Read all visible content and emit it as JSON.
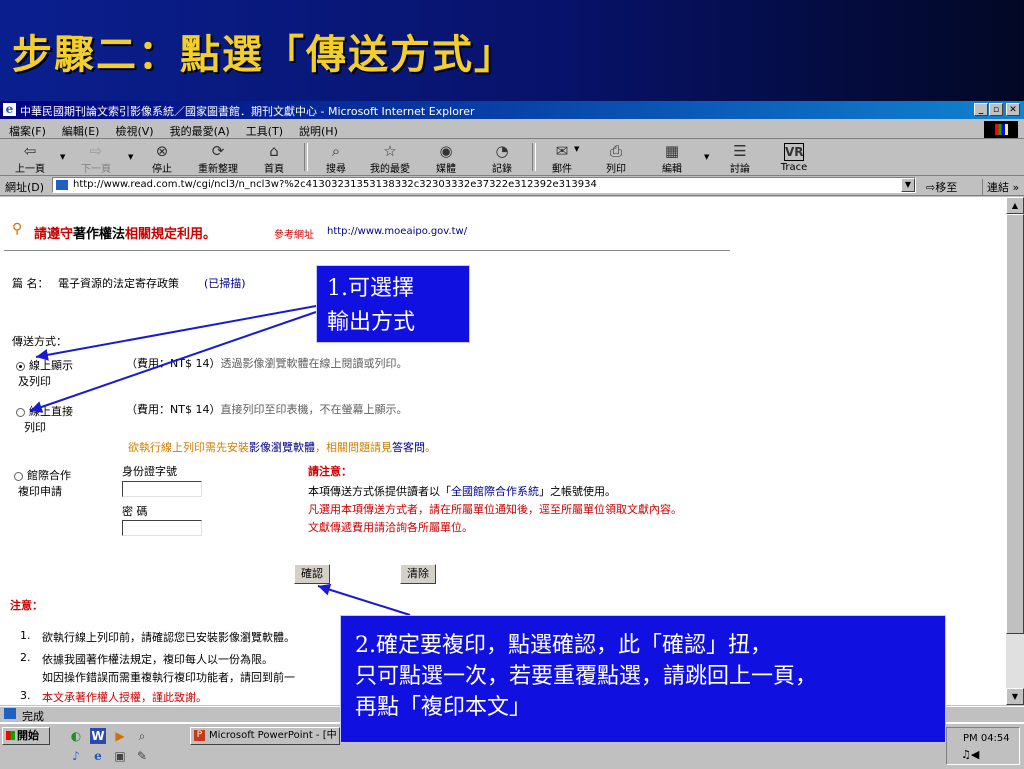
{
  "slide": {
    "title": "步驟二：點選「傳送方式」"
  },
  "window": {
    "title": "中華民國期刊論文索引影像系統／國家圖書館．期刊文獻中心 - Microsoft Internet Explorer",
    "controls": [
      "_",
      "▫",
      "✕"
    ]
  },
  "menu": [
    "檔案(F)",
    "編輯(E)",
    "檢視(V)",
    "我的最愛(A)",
    "工具(T)",
    "說明(H)"
  ],
  "toolbar": {
    "back": "上一頁",
    "forward": "下一頁",
    "stop": "停止",
    "refresh": "重新整理",
    "home": "首頁",
    "search": "搜尋",
    "favorites": "我的最愛",
    "media": "媒體",
    "history": "記錄",
    "mail": "郵件",
    "print": "列印",
    "edit": "編輯",
    "discuss": "討論",
    "trace": "Trace"
  },
  "address": {
    "label": "網址(D)",
    "url": "http://www.read.com.tw/cgi/ncl3/n_ncl3w?%2c41303231353138332c32303332e37322e312392e313934",
    "go": "移至",
    "links": "連結"
  },
  "page": {
    "notice_prefix": "請遵守",
    "notice_law": "著作權法",
    "notice_suffix": "相關規定利用。",
    "ref_label": "參考網址",
    "ref_url": "http://www.moeaipo.gov.tw/",
    "article_label": "篇 名：",
    "article_title": "電子資源的法定寄存政策",
    "scanned": "(已掃描)",
    "delivery_label": "傳送方式：",
    "option1_line1": "線上顯示",
    "option1_line2": "及列印",
    "option1_desc_prefix": "（費用：NT$ 14）",
    "option1_desc": "透過影像瀏覽軟體在線上閱讀或列印。",
    "option2_line1": "線上直接",
    "option2_line2": "列印",
    "option2_desc_prefix": "（費用：NT$ 14）",
    "option2_desc": "直接列印至印表機，不在螢幕上顯示。",
    "install_prefix": "欲執行線上列印需先安裝",
    "install_link": "影像瀏覽軟體",
    "install_mid": "，相關問題請見",
    "install_faq": "答客問",
    "install_end": "。",
    "option3_line1": "館際合作",
    "option3_line2": "複印申請",
    "id_label": "身份證字號",
    "password_label": "密 碼",
    "attention_label": "請注意：",
    "attention1_prefix": "本項傳送方式係提供讀者以「",
    "attention1_link": "全國館際合作系統",
    "attention1_suffix": "」之帳號使用。",
    "attention2": "凡選用本項傳送方式者，請在所屬單位通知後，逕至所屬單位領取文獻內容。",
    "attention3": "文獻傳遞費用請洽詢各所屬單位。",
    "confirm_btn": "確認",
    "clear_btn": "清除",
    "note_label": "注意：",
    "notes": [
      {
        "num": "1.",
        "text": "欲執行線上列印前，請確認您已安裝影像瀏覽軟體。"
      },
      {
        "num": "2.",
        "text": "依據我國著作權法規定，複印每人以一份為限。"
      },
      {
        "num": "",
        "text": "如因操作錯誤而需重複執行複印功能者，請回到前一"
      },
      {
        "num": "3.",
        "text": "本文承著作權人授權，謹此致謝。"
      }
    ]
  },
  "status": {
    "text": "完成"
  },
  "taskbar": {
    "start": "開始",
    "ppt_task": "Microsoft PowerPoint - [中",
    "clock": "PM 04:54"
  },
  "callouts": {
    "c1_line1": "1.可選擇",
    "c1_line2": "輸出方式",
    "c2_line1": "2.確定要複印，點選確認，此「確認」扭，",
    "c2_line2": "只可點選一次，若要重覆點選，請跳回上一頁，",
    "c2_line3": "再點「複印本文」"
  },
  "colors": {
    "slide_bg": "#07126a",
    "title": "#f2cf2a",
    "callout_bg": "#1010e0",
    "arrow": "#1a1ad0"
  }
}
